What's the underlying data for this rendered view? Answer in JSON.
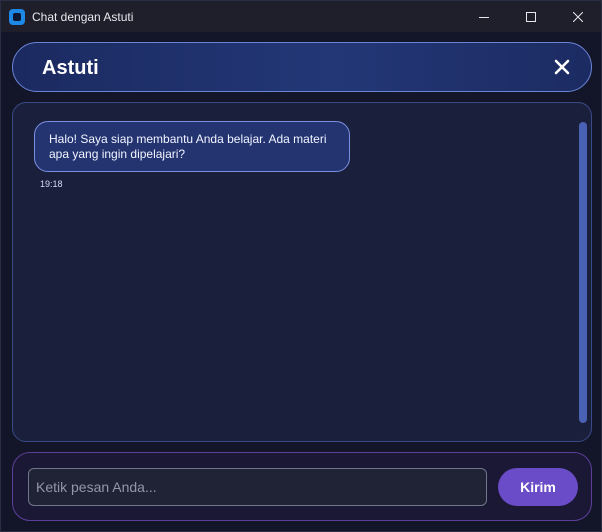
{
  "window": {
    "title": "Chat dengan Astuti",
    "icon": "app-icon",
    "controls": [
      "minimize-icon",
      "maximize-icon",
      "close-icon"
    ]
  },
  "header": {
    "contact_name": "Astuti",
    "close_icon": "close-icon"
  },
  "messages": [
    {
      "sender": "Astuti",
      "text": "Halo! Saya siap membantu Anda belajar. Ada materi apa yang ingin dipelajari?",
      "time": "19:18"
    }
  ],
  "composer": {
    "placeholder": "Ketik pesan Anda...",
    "value": "",
    "send_label": "Kirim"
  },
  "colors": {
    "background": "#131628",
    "header_gradient_start": "#1b2a60",
    "header_border": "#6b84d6",
    "bubble_background": "#233471",
    "bubble_border": "#7a8fe0",
    "scrollbar_thumb": "#4a62b5",
    "input_panel_border": "#5d3f9a",
    "send_button": "#6a4cc8"
  }
}
